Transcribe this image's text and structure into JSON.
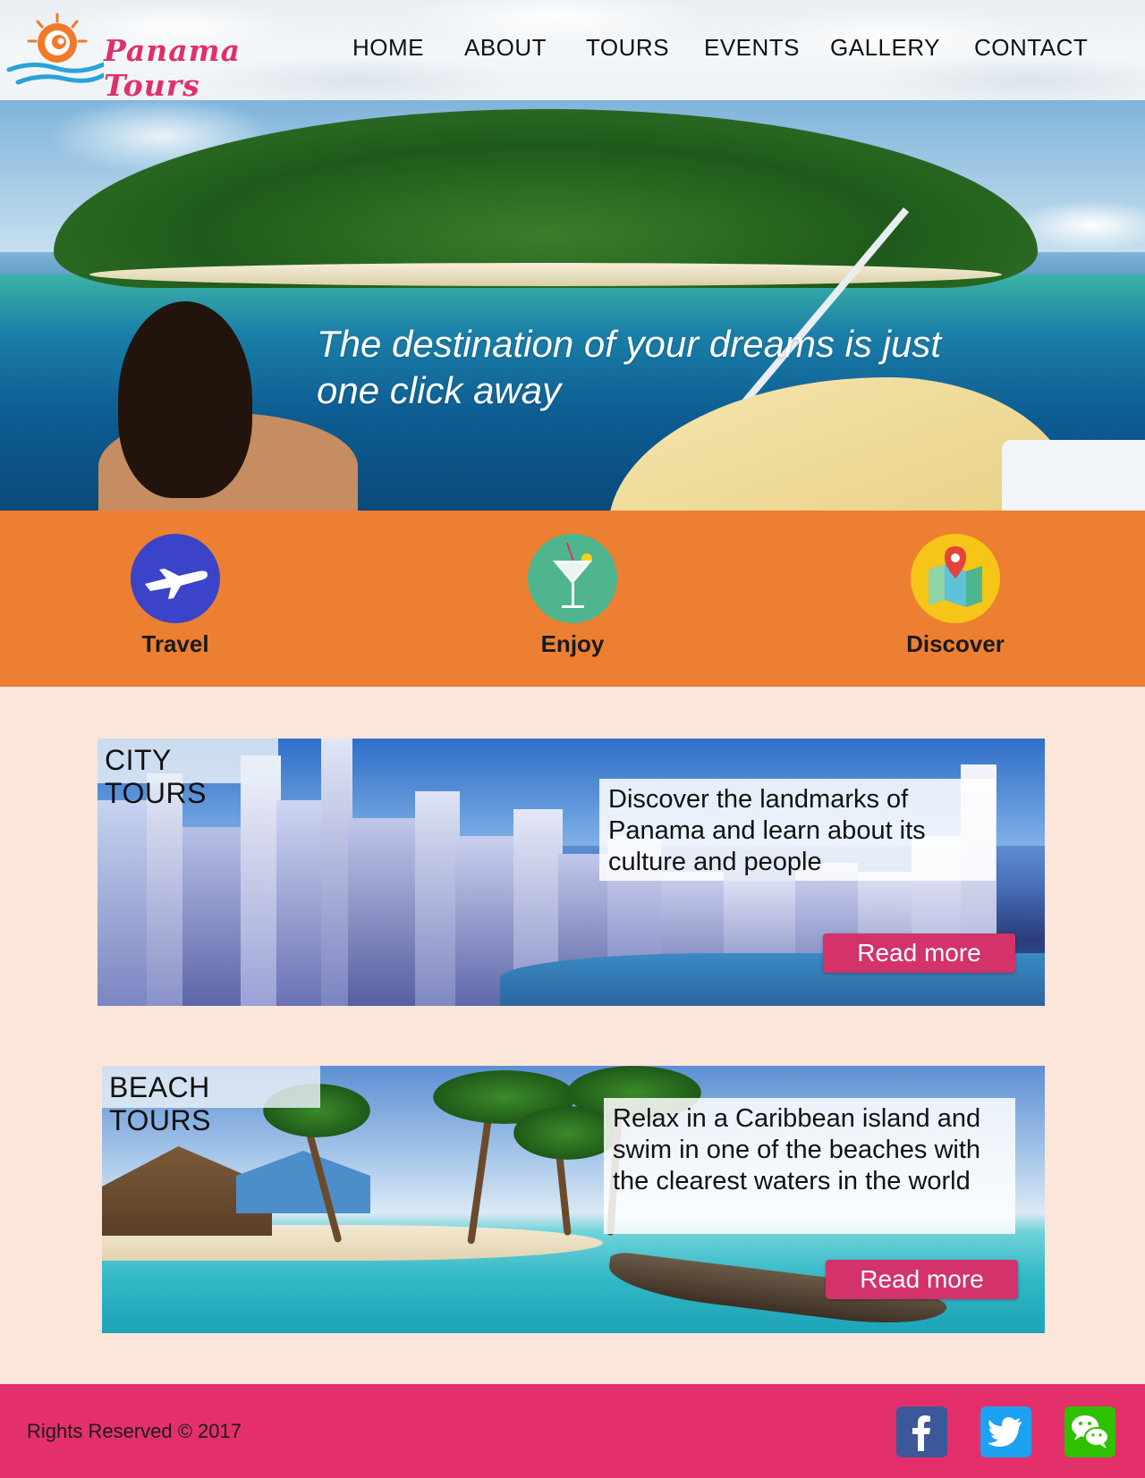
{
  "brand": {
    "name": "Panama Tours",
    "logo_icon": "sun-wave-logo",
    "accent_color": "#e0306a"
  },
  "nav": {
    "items": [
      {
        "label": "HOME"
      },
      {
        "label": "ABOUT"
      },
      {
        "label": "TOURS"
      },
      {
        "label": "EVENTS"
      },
      {
        "label": "GALLERY"
      },
      {
        "label": "CONTACT"
      }
    ]
  },
  "hero": {
    "tagline": "The destination of your dreams is just one click away"
  },
  "features": {
    "background_color": "#ed7f32",
    "items": [
      {
        "label": "Travel",
        "icon": "airplane-icon",
        "color": "#3b44c8"
      },
      {
        "label": "Enjoy",
        "icon": "cocktail-icon",
        "color": "#4fb58e"
      },
      {
        "label": "Discover",
        "icon": "map-pin-icon",
        "color": "#f5c518"
      }
    ]
  },
  "tours": [
    {
      "title": "CITY TOURS",
      "description": "Discover the landmarks of Panama and learn about its culture and people",
      "button_label": "Read more"
    },
    {
      "title": "BEACH TOURS",
      "description": "Relax in a Caribbean island and swim in one of the beaches with the clearest waters in the world",
      "button_label": "Read more"
    }
  ],
  "footer": {
    "rights": "Rights Reserved © 2017",
    "background_color": "#e3306b",
    "social": [
      {
        "icon": "facebook-icon",
        "color": "#3b5998"
      },
      {
        "icon": "twitter-icon",
        "color": "#1da1f2"
      },
      {
        "icon": "wechat-icon",
        "color": "#2dc100"
      }
    ]
  }
}
